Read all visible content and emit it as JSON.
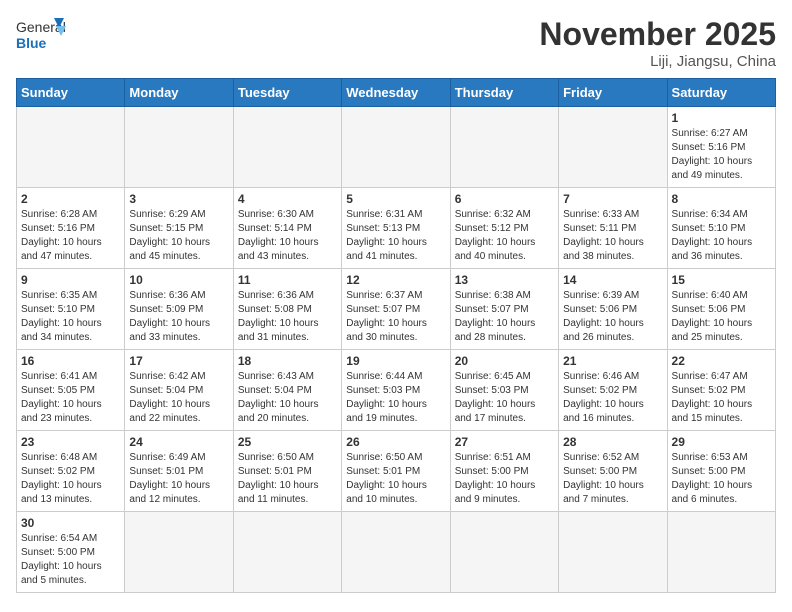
{
  "logo": {
    "text_general": "General",
    "text_blue": "Blue"
  },
  "header": {
    "month_title": "November 2025",
    "location": "Liji, Jiangsu, China"
  },
  "weekdays": [
    "Sunday",
    "Monday",
    "Tuesday",
    "Wednesday",
    "Thursday",
    "Friday",
    "Saturday"
  ],
  "weeks": [
    [
      {
        "day": "",
        "empty": true
      },
      {
        "day": "",
        "empty": true
      },
      {
        "day": "",
        "empty": true
      },
      {
        "day": "",
        "empty": true
      },
      {
        "day": "",
        "empty": true
      },
      {
        "day": "",
        "empty": true
      },
      {
        "day": "1",
        "sunrise": "Sunrise: 6:27 AM",
        "sunset": "Sunset: 5:16 PM",
        "daylight": "Daylight: 10 hours and 49 minutes."
      }
    ],
    [
      {
        "day": "2",
        "sunrise": "Sunrise: 6:28 AM",
        "sunset": "Sunset: 5:16 PM",
        "daylight": "Daylight: 10 hours and 47 minutes."
      },
      {
        "day": "3",
        "sunrise": "Sunrise: 6:29 AM",
        "sunset": "Sunset: 5:15 PM",
        "daylight": "Daylight: 10 hours and 45 minutes."
      },
      {
        "day": "4",
        "sunrise": "Sunrise: 6:30 AM",
        "sunset": "Sunset: 5:14 PM",
        "daylight": "Daylight: 10 hours and 43 minutes."
      },
      {
        "day": "5",
        "sunrise": "Sunrise: 6:31 AM",
        "sunset": "Sunset: 5:13 PM",
        "daylight": "Daylight: 10 hours and 41 minutes."
      },
      {
        "day": "6",
        "sunrise": "Sunrise: 6:32 AM",
        "sunset": "Sunset: 5:12 PM",
        "daylight": "Daylight: 10 hours and 40 minutes."
      },
      {
        "day": "7",
        "sunrise": "Sunrise: 6:33 AM",
        "sunset": "Sunset: 5:11 PM",
        "daylight": "Daylight: 10 hours and 38 minutes."
      },
      {
        "day": "8",
        "sunrise": "Sunrise: 6:34 AM",
        "sunset": "Sunset: 5:10 PM",
        "daylight": "Daylight: 10 hours and 36 minutes."
      }
    ],
    [
      {
        "day": "9",
        "sunrise": "Sunrise: 6:35 AM",
        "sunset": "Sunset: 5:10 PM",
        "daylight": "Daylight: 10 hours and 34 minutes."
      },
      {
        "day": "10",
        "sunrise": "Sunrise: 6:36 AM",
        "sunset": "Sunset: 5:09 PM",
        "daylight": "Daylight: 10 hours and 33 minutes."
      },
      {
        "day": "11",
        "sunrise": "Sunrise: 6:36 AM",
        "sunset": "Sunset: 5:08 PM",
        "daylight": "Daylight: 10 hours and 31 minutes."
      },
      {
        "day": "12",
        "sunrise": "Sunrise: 6:37 AM",
        "sunset": "Sunset: 5:07 PM",
        "daylight": "Daylight: 10 hours and 30 minutes."
      },
      {
        "day": "13",
        "sunrise": "Sunrise: 6:38 AM",
        "sunset": "Sunset: 5:07 PM",
        "daylight": "Daylight: 10 hours and 28 minutes."
      },
      {
        "day": "14",
        "sunrise": "Sunrise: 6:39 AM",
        "sunset": "Sunset: 5:06 PM",
        "daylight": "Daylight: 10 hours and 26 minutes."
      },
      {
        "day": "15",
        "sunrise": "Sunrise: 6:40 AM",
        "sunset": "Sunset: 5:06 PM",
        "daylight": "Daylight: 10 hours and 25 minutes."
      }
    ],
    [
      {
        "day": "16",
        "sunrise": "Sunrise: 6:41 AM",
        "sunset": "Sunset: 5:05 PM",
        "daylight": "Daylight: 10 hours and 23 minutes."
      },
      {
        "day": "17",
        "sunrise": "Sunrise: 6:42 AM",
        "sunset": "Sunset: 5:04 PM",
        "daylight": "Daylight: 10 hours and 22 minutes."
      },
      {
        "day": "18",
        "sunrise": "Sunrise: 6:43 AM",
        "sunset": "Sunset: 5:04 PM",
        "daylight": "Daylight: 10 hours and 20 minutes."
      },
      {
        "day": "19",
        "sunrise": "Sunrise: 6:44 AM",
        "sunset": "Sunset: 5:03 PM",
        "daylight": "Daylight: 10 hours and 19 minutes."
      },
      {
        "day": "20",
        "sunrise": "Sunrise: 6:45 AM",
        "sunset": "Sunset: 5:03 PM",
        "daylight": "Daylight: 10 hours and 17 minutes."
      },
      {
        "day": "21",
        "sunrise": "Sunrise: 6:46 AM",
        "sunset": "Sunset: 5:02 PM",
        "daylight": "Daylight: 10 hours and 16 minutes."
      },
      {
        "day": "22",
        "sunrise": "Sunrise: 6:47 AM",
        "sunset": "Sunset: 5:02 PM",
        "daylight": "Daylight: 10 hours and 15 minutes."
      }
    ],
    [
      {
        "day": "23",
        "sunrise": "Sunrise: 6:48 AM",
        "sunset": "Sunset: 5:02 PM",
        "daylight": "Daylight: 10 hours and 13 minutes."
      },
      {
        "day": "24",
        "sunrise": "Sunrise: 6:49 AM",
        "sunset": "Sunset: 5:01 PM",
        "daylight": "Daylight: 10 hours and 12 minutes."
      },
      {
        "day": "25",
        "sunrise": "Sunrise: 6:50 AM",
        "sunset": "Sunset: 5:01 PM",
        "daylight": "Daylight: 10 hours and 11 minutes."
      },
      {
        "day": "26",
        "sunrise": "Sunrise: 6:50 AM",
        "sunset": "Sunset: 5:01 PM",
        "daylight": "Daylight: 10 hours and 10 minutes."
      },
      {
        "day": "27",
        "sunrise": "Sunrise: 6:51 AM",
        "sunset": "Sunset: 5:00 PM",
        "daylight": "Daylight: 10 hours and 9 minutes."
      },
      {
        "day": "28",
        "sunrise": "Sunrise: 6:52 AM",
        "sunset": "Sunset: 5:00 PM",
        "daylight": "Daylight: 10 hours and 7 minutes."
      },
      {
        "day": "29",
        "sunrise": "Sunrise: 6:53 AM",
        "sunset": "Sunset: 5:00 PM",
        "daylight": "Daylight: 10 hours and 6 minutes."
      }
    ],
    [
      {
        "day": "30",
        "sunrise": "Sunrise: 6:54 AM",
        "sunset": "Sunset: 5:00 PM",
        "daylight": "Daylight: 10 hours and 5 minutes."
      },
      {
        "day": "",
        "empty": true
      },
      {
        "day": "",
        "empty": true
      },
      {
        "day": "",
        "empty": true
      },
      {
        "day": "",
        "empty": true
      },
      {
        "day": "",
        "empty": true
      },
      {
        "day": "",
        "empty": true
      }
    ]
  ]
}
